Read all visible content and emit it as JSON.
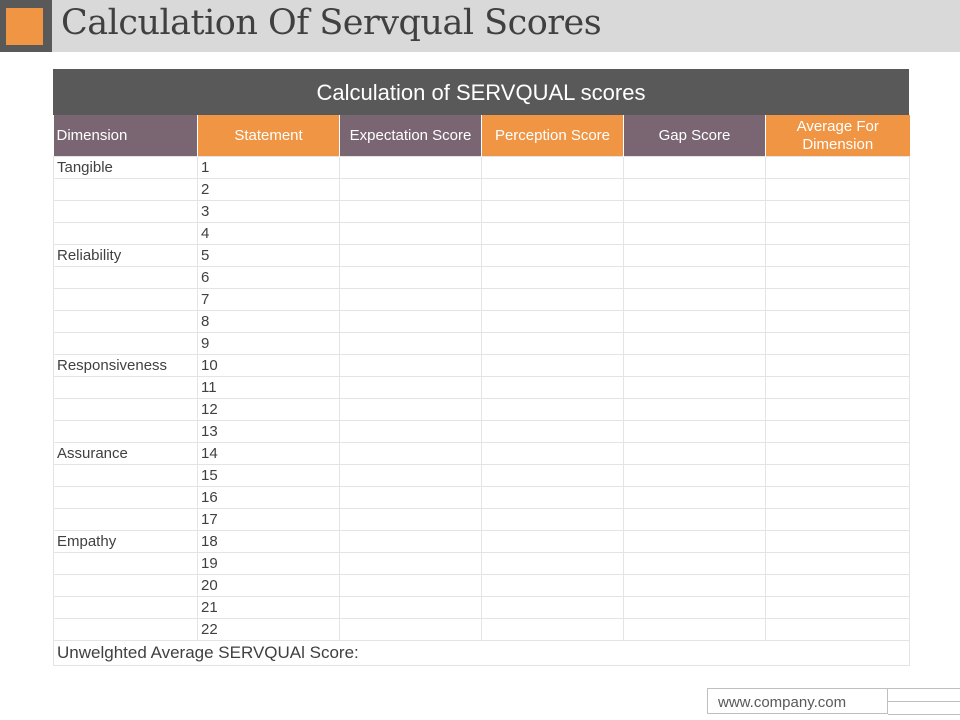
{
  "slide": {
    "title": "Calculation Of Servqual Scores",
    "footer_url": "www.company.com"
  },
  "table": {
    "caption": "Calculation of SERVQUAL scores",
    "headers": [
      "Dimension",
      "Statement",
      "Expectation Score",
      "Perception Score",
      "Gap Score",
      "Average For Dimension"
    ],
    "rows": [
      [
        "Tangible",
        "1"
      ],
      [
        "",
        "2"
      ],
      [
        "",
        "3"
      ],
      [
        "",
        "4"
      ],
      [
        "Reliability",
        "5"
      ],
      [
        "",
        "6"
      ],
      [
        "",
        "7"
      ],
      [
        "",
        "8"
      ],
      [
        "",
        "9"
      ],
      [
        "Responsiveness",
        "10"
      ],
      [
        "",
        "11"
      ],
      [
        "",
        "12"
      ],
      [
        "",
        "13"
      ],
      [
        "Assurance",
        "14"
      ],
      [
        "",
        "15"
      ],
      [
        "",
        "16"
      ],
      [
        "",
        "17"
      ],
      [
        "Empathy",
        "18"
      ],
      [
        "",
        "19"
      ],
      [
        "",
        "20"
      ],
      [
        "",
        "21"
      ],
      [
        "",
        "22"
      ]
    ],
    "footer_label": "Unwelghted Average SERVQUAl Score:"
  },
  "colors": {
    "accent_orange": "#ef9544",
    "header_mauve": "#7a6672",
    "caption_gray": "#595959",
    "title_bar_gray": "#d9d9d9"
  }
}
